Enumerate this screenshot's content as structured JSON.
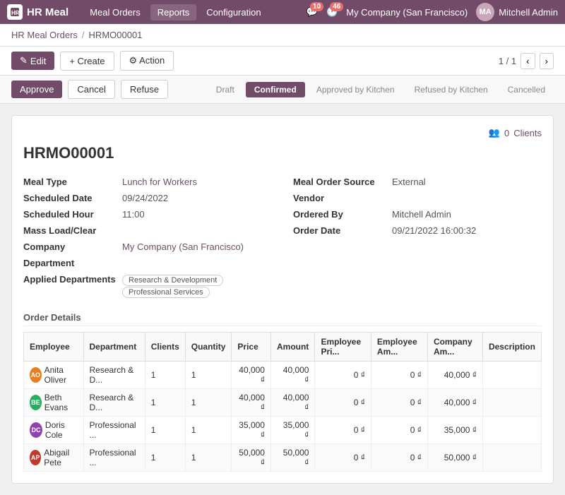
{
  "topnav": {
    "brand": "HR Meal",
    "links": [
      "Meal Orders",
      "Reports",
      "Configuration"
    ],
    "chat_count": 10,
    "todo_count": 46,
    "company": "My Company (San Francisco)",
    "user": "Mitchell Admin"
  },
  "breadcrumb": {
    "parent": "HR Meal Orders",
    "current": "HRMO00001"
  },
  "toolbar": {
    "edit_label": "Edit",
    "create_label": "+ Create",
    "action_label": "⚙ Action",
    "page_info": "1 / 1"
  },
  "status_bar": {
    "approve_label": "Approve",
    "cancel_label": "Cancel",
    "refuse_label": "Refuse",
    "steps": [
      "Draft",
      "Confirmed",
      "Approved by Kitchen",
      "Refused by Kitchen",
      "Cancelled"
    ],
    "active_step": "Confirmed"
  },
  "form": {
    "title": "HRMO00001",
    "clients_count": 0,
    "clients_label": "Clients",
    "left_fields": [
      {
        "label": "Meal Type",
        "value": "Lunch for Workers",
        "link": true
      },
      {
        "label": "Scheduled Date",
        "value": "09/24/2022",
        "link": false
      },
      {
        "label": "Scheduled Hour",
        "value": "11:00",
        "link": false
      },
      {
        "label": "Mass Load/Clear",
        "value": "",
        "link": false
      },
      {
        "label": "Company",
        "value": "My Company (San Francisco)",
        "link": true
      },
      {
        "label": "Department",
        "value": "",
        "link": false
      },
      {
        "label": "Applied Departments",
        "value": "",
        "link": false,
        "tags": [
          "Research & Development",
          "Professional Services"
        ]
      }
    ],
    "right_fields": [
      {
        "label": "Meal Order Source",
        "value": "External",
        "link": false
      },
      {
        "label": "Vendor",
        "value": "",
        "link": false
      },
      {
        "label": "Ordered By",
        "value": "Mitchell Admin",
        "link": false
      },
      {
        "label": "Order Date",
        "value": "09/21/2022 16:00:32",
        "link": false
      }
    ],
    "order_details_label": "Order Details",
    "table": {
      "columns": [
        "Employee",
        "Department",
        "Clients",
        "Quantity",
        "Price",
        "Amount",
        "Employee Pri...",
        "Employee Am...",
        "Company Am...",
        "Description"
      ],
      "rows": [
        {
          "employee": "Anita Oliver",
          "department": "Research & D...",
          "clients": "1",
          "quantity": "1",
          "price": "40,000 ₫",
          "amount": "40,000 ₫",
          "emp_price": "0 ₫",
          "emp_amount": "0 ₫",
          "company_amount": "40,000 ₫",
          "description": "",
          "avatar_color": "#e67e22"
        },
        {
          "employee": "Beth Evans",
          "department": "Research & D...",
          "clients": "1",
          "quantity": "1",
          "price": "40,000 ₫",
          "amount": "40,000 ₫",
          "emp_price": "0 ₫",
          "emp_amount": "0 ₫",
          "company_amount": "40,000 ₫",
          "description": "",
          "avatar_color": "#27ae60"
        },
        {
          "employee": "Doris Cole",
          "department": "Professional ...",
          "clients": "1",
          "quantity": "1",
          "price": "35,000 ₫",
          "amount": "35,000 ₫",
          "emp_price": "0 ₫",
          "emp_amount": "0 ₫",
          "company_amount": "35,000 ₫",
          "description": "",
          "avatar_color": "#8e44ad"
        },
        {
          "employee": "Abigail Pete",
          "department": "Professional ...",
          "clients": "1",
          "quantity": "1",
          "price": "50,000 ₫",
          "amount": "50,000 ₫",
          "emp_price": "0 ₫",
          "emp_amount": "0 ₫",
          "company_amount": "50,000 ₫",
          "description": "",
          "avatar_color": "#c0392b"
        }
      ]
    }
  },
  "icons": {
    "pencil": "✎",
    "gear": "⚙",
    "people": "👥",
    "chevron_left": "‹",
    "chevron_right": "›"
  }
}
